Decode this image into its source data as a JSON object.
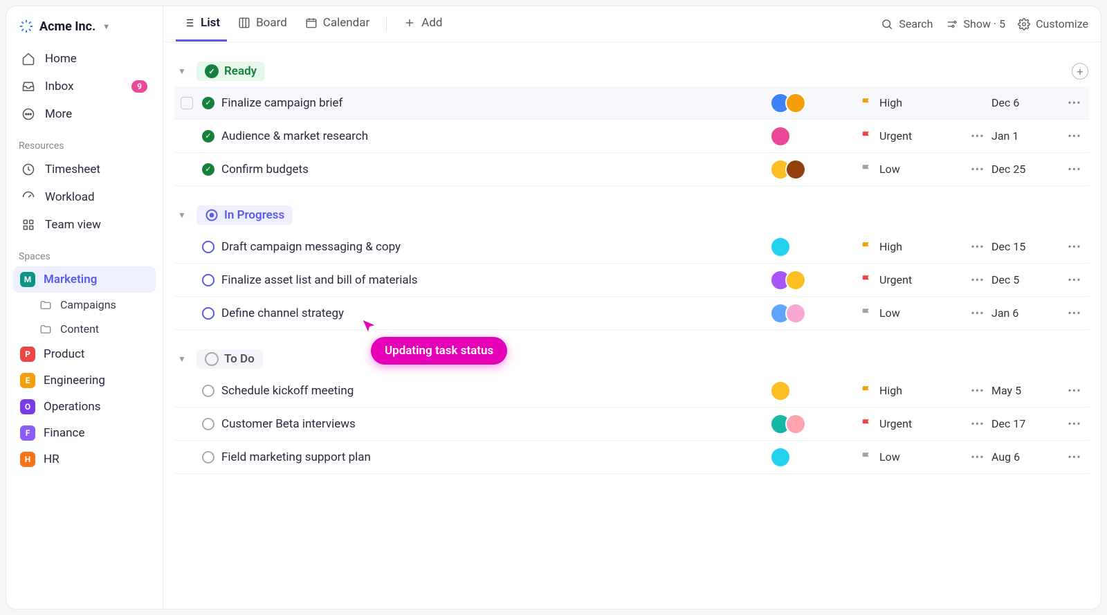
{
  "workspace": {
    "name": "Acme Inc."
  },
  "sidebar": {
    "nav": {
      "home": "Home",
      "inbox": "Inbox",
      "inbox_badge": "9",
      "more": "More"
    },
    "resources_label": "Resources",
    "resources": {
      "timesheet": "Timesheet",
      "workload": "Workload",
      "teamview": "Team view"
    },
    "spaces_label": "Spaces",
    "spaces": [
      {
        "letter": "M",
        "name": "Marketing",
        "color": "#0d9488",
        "selected": true,
        "children": [
          {
            "name": "Campaigns"
          },
          {
            "name": "Content"
          }
        ]
      },
      {
        "letter": "P",
        "name": "Product",
        "color": "#ef4444"
      },
      {
        "letter": "E",
        "name": "Engineering",
        "color": "#f59e0b"
      },
      {
        "letter": "O",
        "name": "Operations",
        "color": "#7c3aed"
      },
      {
        "letter": "F",
        "name": "Finance",
        "color": "#8b5cf6"
      },
      {
        "letter": "H",
        "name": "HR",
        "color": "#f97316"
      }
    ]
  },
  "topbar": {
    "views": {
      "list": "List",
      "board": "Board",
      "calendar": "Calendar",
      "add": "Add"
    },
    "right": {
      "search": "Search",
      "show": "Show · 5",
      "customize": "Customize"
    }
  },
  "groups": [
    {
      "name": "Ready",
      "pill": "pill-ready",
      "icon": "done",
      "tasks": [
        {
          "title": "Finalize campaign brief",
          "status": "done",
          "chk": true,
          "av": [
            "#3b82f6",
            "#f59e0b"
          ],
          "priority": "High",
          "flag": "#f59e0b",
          "date": "Dec 6",
          "more": false
        },
        {
          "title": "Audience & market research",
          "status": "done",
          "chk": false,
          "av": [
            "#ec4899"
          ],
          "priority": "Urgent",
          "flag": "#ef4444",
          "date": "Jan 1",
          "more": true
        },
        {
          "title": "Confirm budgets",
          "status": "done",
          "chk": false,
          "av": [
            "#fbbf24",
            "#92400e"
          ],
          "priority": "Low",
          "flag": "#9ca3af",
          "date": "Dec 25",
          "more": true
        }
      ],
      "show_add": true
    },
    {
      "name": "In Progress",
      "pill": "pill-prog",
      "icon": "prog",
      "tasks": [
        {
          "title": "Draft campaign messaging & copy",
          "status": "open",
          "chk": false,
          "av": [
            "#22d3ee"
          ],
          "priority": "High",
          "flag": "#f59e0b",
          "date": "Dec 15",
          "more": true
        },
        {
          "title": "Finalize asset list and bill of materials",
          "status": "open",
          "chk": false,
          "av": [
            "#a855f7",
            "#fbbf24"
          ],
          "priority": "Urgent",
          "flag": "#ef4444",
          "date": "Dec 5",
          "more": true
        },
        {
          "title": "Define channel strategy",
          "status": "open",
          "chk": false,
          "av": [
            "#60a5fa",
            "#f9a8d4"
          ],
          "priority": "Low",
          "flag": "#9ca3af",
          "date": "Jan 6",
          "more": true
        }
      ]
    },
    {
      "name": "To Do",
      "pill": "pill-todo",
      "icon": "todo",
      "tasks": [
        {
          "title": "Schedule kickoff meeting",
          "status": "todo",
          "chk": false,
          "av": [
            "#fbbf24"
          ],
          "priority": "High",
          "flag": "#f59e0b",
          "date": "May 5",
          "more": true
        },
        {
          "title": "Customer Beta interviews",
          "status": "todo",
          "chk": false,
          "av": [
            "#14b8a6",
            "#fda4af"
          ],
          "priority": "Urgent",
          "flag": "#ef4444",
          "date": "Dec 17",
          "more": true
        },
        {
          "title": "Field marketing support plan",
          "status": "todo",
          "chk": false,
          "av": [
            "#22d3ee"
          ],
          "priority": "Low",
          "flag": "#9ca3af",
          "date": "Aug 6",
          "more": true
        }
      ]
    }
  ],
  "toast": "Updating task status"
}
